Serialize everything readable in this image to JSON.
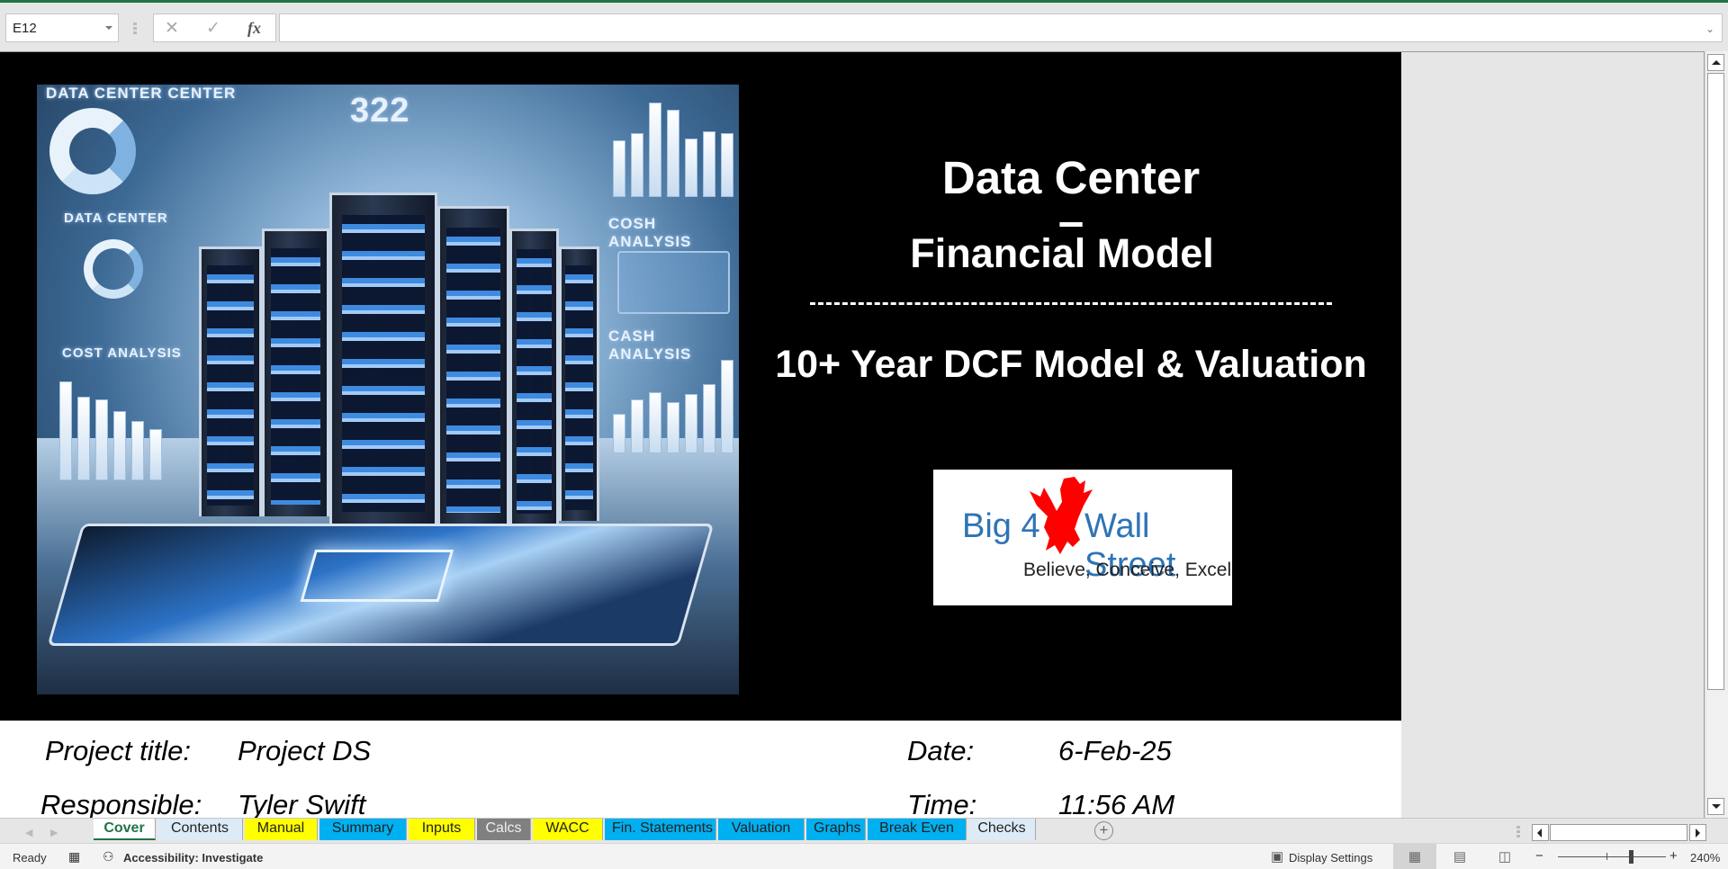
{
  "formula_bar": {
    "name_box": "E12",
    "cancel_icon": "✕",
    "enter_icon": "✓",
    "fx_label": "fx",
    "formula_value": "",
    "expand_icon": "⌄"
  },
  "cover": {
    "title_line1": "Data Center",
    "title_dash": "–",
    "title_line2": "Financial Model",
    "subtitle": "10+ Year DCF Model & Valuation",
    "hero_image": {
      "alt": "Data center server racks with financial dashboards",
      "hud_labels": [
        "DATA CENTER  CENTER",
        "DATA CENTER",
        "COST ANALYSIS",
        "COSH ANALYSIS",
        "CASH ANALYSIS",
        "322"
      ]
    },
    "logo": {
      "left_text": "Big 4",
      "right_text": "Wall Street",
      "tagline": "Believe, Conceive, Excel",
      "brand_color": "#2e74b5",
      "eagle_color": "#ff0000"
    },
    "info": {
      "project_title_label": "Project title:",
      "project_title_value": "Project DS",
      "responsible_label": "Responsible:",
      "responsible_value": "Tyler Swift",
      "date_label": "Date:",
      "date_value": "6-Feb-25",
      "time_label": "Time:",
      "time_value": "11:56 AM"
    }
  },
  "sheet_tabs": [
    {
      "label": "Cover",
      "color": "#ffffff",
      "active": true
    },
    {
      "label": "Contents",
      "color": "#ddebf7",
      "active": false
    },
    {
      "label": "Manual",
      "color": "#ffff00",
      "active": false
    },
    {
      "label": "Summary",
      "color": "#00b0f0",
      "active": false
    },
    {
      "label": "Inputs",
      "color": "#ffff00",
      "active": false
    },
    {
      "label": "Calcs",
      "color": "#808080",
      "active": false
    },
    {
      "label": "WACC",
      "color": "#ffff00",
      "active": false
    },
    {
      "label": "Fin. Statements",
      "color": "#00b0f0",
      "active": false
    },
    {
      "label": "Valuation",
      "color": "#00b0f0",
      "active": false
    },
    {
      "label": "Graphs",
      "color": "#00b0f0",
      "active": false
    },
    {
      "label": "Break Even",
      "color": "#00b0f0",
      "active": false
    },
    {
      "label": "Checks",
      "color": "#ddebf7",
      "active": false
    }
  ],
  "add_sheet_label": "+",
  "status_bar": {
    "ready": "Ready",
    "accessibility": "Accessibility: Investigate",
    "display_settings": "Display Settings",
    "zoom_minus": "−",
    "zoom_plus": "+",
    "zoom_level": "240%",
    "zoom_percent": 240
  }
}
